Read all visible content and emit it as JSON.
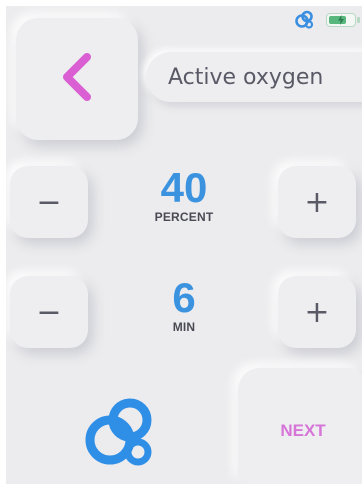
{
  "status_bar": {
    "connection_icon": "linked-circles-icon",
    "battery_icon": "battery-charging-icon",
    "battery_level": 0.75
  },
  "header": {
    "back_icon": "chevron-left-icon",
    "mode_label": "Active oxygen"
  },
  "settings": [
    {
      "value": "40",
      "unit": "PERCENT",
      "decrease_symbol": "−",
      "increase_symbol": "+"
    },
    {
      "value": "6",
      "unit": "MIN",
      "decrease_symbol": "−",
      "increase_symbol": "+"
    }
  ],
  "footer": {
    "logo_icon": "linked-circles-icon",
    "next_label": "NEXT"
  },
  "colors": {
    "accent_pink": "#d95fd3",
    "accent_blue": "#3b93e0",
    "background": "#ececee",
    "battery_green": "#57b77d"
  }
}
